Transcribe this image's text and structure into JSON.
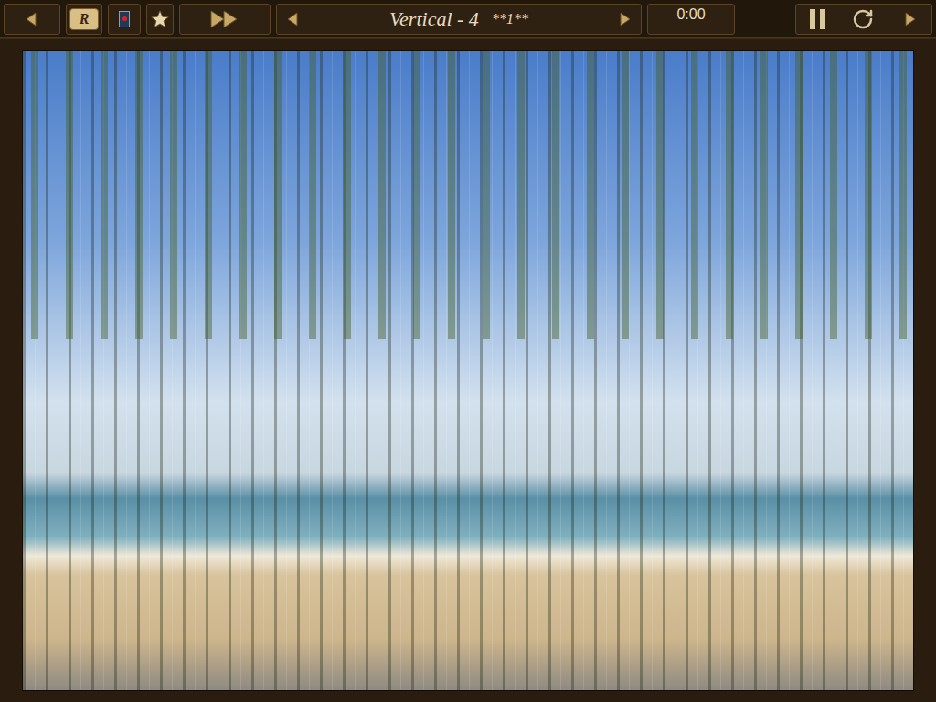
{
  "toolbar": {
    "logo_letter": "R"
  },
  "title_bar": {
    "title": "Vertical - 4",
    "marker": "**1**"
  },
  "timer": "0:00",
  "board": {
    "description": "beach photograph cut into vertical strips"
  }
}
